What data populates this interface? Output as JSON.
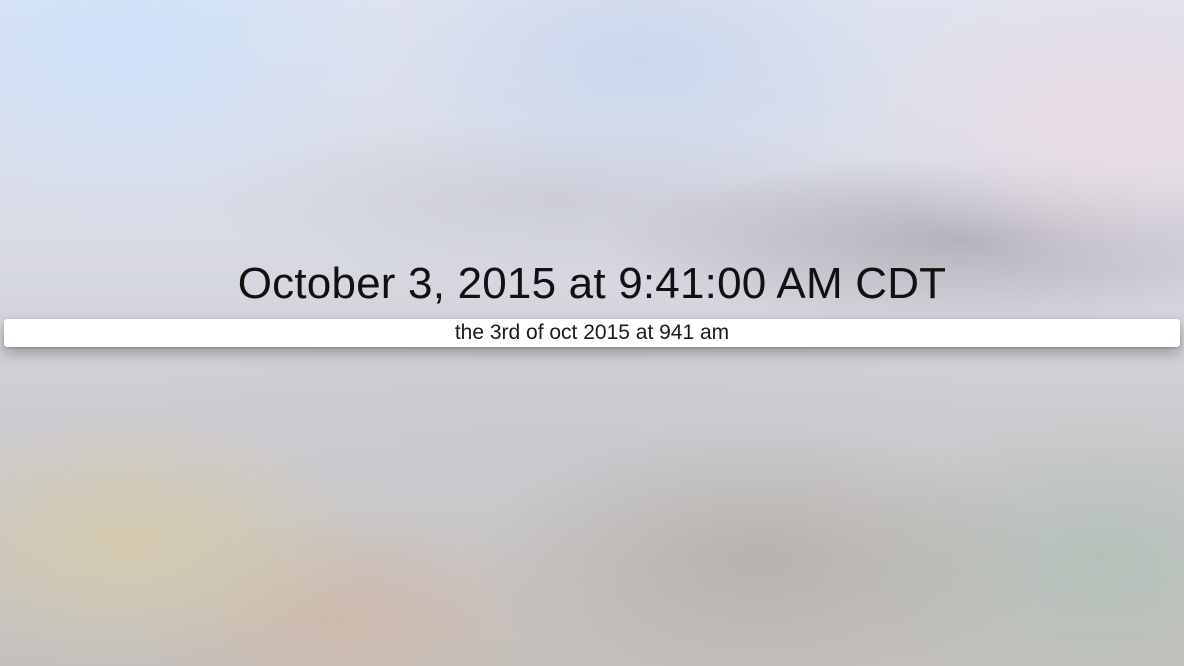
{
  "parsed_result": {
    "text": "October 3, 2015 at 9:41:00 AM CDT"
  },
  "date_input": {
    "value": "the 3rd of oct 2015 at 941 am"
  }
}
